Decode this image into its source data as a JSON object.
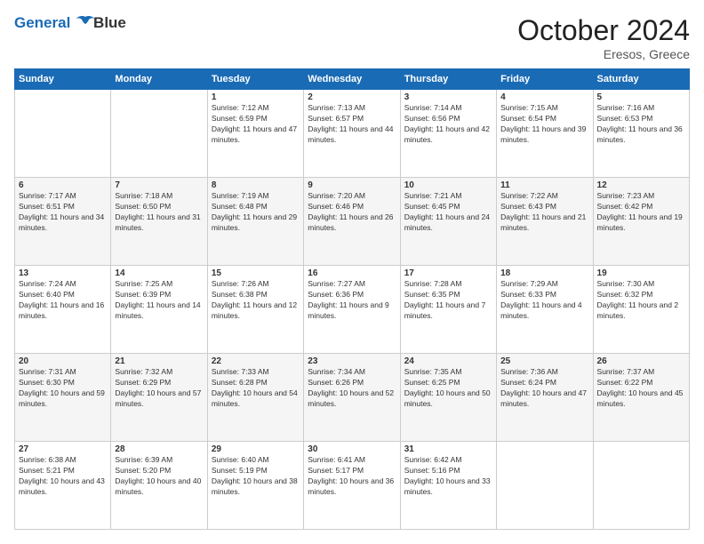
{
  "header": {
    "logo_line1": "General",
    "logo_line2": "Blue",
    "month": "October 2024",
    "location": "Eresos, Greece"
  },
  "weekdays": [
    "Sunday",
    "Monday",
    "Tuesday",
    "Wednesday",
    "Thursday",
    "Friday",
    "Saturday"
  ],
  "weeks": [
    [
      {
        "day": null,
        "content": null
      },
      {
        "day": null,
        "content": null
      },
      {
        "day": "1",
        "content": "Sunrise: 7:12 AM\nSunset: 6:59 PM\nDaylight: 11 hours and 47 minutes."
      },
      {
        "day": "2",
        "content": "Sunrise: 7:13 AM\nSunset: 6:57 PM\nDaylight: 11 hours and 44 minutes."
      },
      {
        "day": "3",
        "content": "Sunrise: 7:14 AM\nSunset: 6:56 PM\nDaylight: 11 hours and 42 minutes."
      },
      {
        "day": "4",
        "content": "Sunrise: 7:15 AM\nSunset: 6:54 PM\nDaylight: 11 hours and 39 minutes."
      },
      {
        "day": "5",
        "content": "Sunrise: 7:16 AM\nSunset: 6:53 PM\nDaylight: 11 hours and 36 minutes."
      }
    ],
    [
      {
        "day": "6",
        "content": "Sunrise: 7:17 AM\nSunset: 6:51 PM\nDaylight: 11 hours and 34 minutes."
      },
      {
        "day": "7",
        "content": "Sunrise: 7:18 AM\nSunset: 6:50 PM\nDaylight: 11 hours and 31 minutes."
      },
      {
        "day": "8",
        "content": "Sunrise: 7:19 AM\nSunset: 6:48 PM\nDaylight: 11 hours and 29 minutes."
      },
      {
        "day": "9",
        "content": "Sunrise: 7:20 AM\nSunset: 6:46 PM\nDaylight: 11 hours and 26 minutes."
      },
      {
        "day": "10",
        "content": "Sunrise: 7:21 AM\nSunset: 6:45 PM\nDaylight: 11 hours and 24 minutes."
      },
      {
        "day": "11",
        "content": "Sunrise: 7:22 AM\nSunset: 6:43 PM\nDaylight: 11 hours and 21 minutes."
      },
      {
        "day": "12",
        "content": "Sunrise: 7:23 AM\nSunset: 6:42 PM\nDaylight: 11 hours and 19 minutes."
      }
    ],
    [
      {
        "day": "13",
        "content": "Sunrise: 7:24 AM\nSunset: 6:40 PM\nDaylight: 11 hours and 16 minutes."
      },
      {
        "day": "14",
        "content": "Sunrise: 7:25 AM\nSunset: 6:39 PM\nDaylight: 11 hours and 14 minutes."
      },
      {
        "day": "15",
        "content": "Sunrise: 7:26 AM\nSunset: 6:38 PM\nDaylight: 11 hours and 12 minutes."
      },
      {
        "day": "16",
        "content": "Sunrise: 7:27 AM\nSunset: 6:36 PM\nDaylight: 11 hours and 9 minutes."
      },
      {
        "day": "17",
        "content": "Sunrise: 7:28 AM\nSunset: 6:35 PM\nDaylight: 11 hours and 7 minutes."
      },
      {
        "day": "18",
        "content": "Sunrise: 7:29 AM\nSunset: 6:33 PM\nDaylight: 11 hours and 4 minutes."
      },
      {
        "day": "19",
        "content": "Sunrise: 7:30 AM\nSunset: 6:32 PM\nDaylight: 11 hours and 2 minutes."
      }
    ],
    [
      {
        "day": "20",
        "content": "Sunrise: 7:31 AM\nSunset: 6:30 PM\nDaylight: 10 hours and 59 minutes."
      },
      {
        "day": "21",
        "content": "Sunrise: 7:32 AM\nSunset: 6:29 PM\nDaylight: 10 hours and 57 minutes."
      },
      {
        "day": "22",
        "content": "Sunrise: 7:33 AM\nSunset: 6:28 PM\nDaylight: 10 hours and 54 minutes."
      },
      {
        "day": "23",
        "content": "Sunrise: 7:34 AM\nSunset: 6:26 PM\nDaylight: 10 hours and 52 minutes."
      },
      {
        "day": "24",
        "content": "Sunrise: 7:35 AM\nSunset: 6:25 PM\nDaylight: 10 hours and 50 minutes."
      },
      {
        "day": "25",
        "content": "Sunrise: 7:36 AM\nSunset: 6:24 PM\nDaylight: 10 hours and 47 minutes."
      },
      {
        "day": "26",
        "content": "Sunrise: 7:37 AM\nSunset: 6:22 PM\nDaylight: 10 hours and 45 minutes."
      }
    ],
    [
      {
        "day": "27",
        "content": "Sunrise: 6:38 AM\nSunset: 5:21 PM\nDaylight: 10 hours and 43 minutes."
      },
      {
        "day": "28",
        "content": "Sunrise: 6:39 AM\nSunset: 5:20 PM\nDaylight: 10 hours and 40 minutes."
      },
      {
        "day": "29",
        "content": "Sunrise: 6:40 AM\nSunset: 5:19 PM\nDaylight: 10 hours and 38 minutes."
      },
      {
        "day": "30",
        "content": "Sunrise: 6:41 AM\nSunset: 5:17 PM\nDaylight: 10 hours and 36 minutes."
      },
      {
        "day": "31",
        "content": "Sunrise: 6:42 AM\nSunset: 5:16 PM\nDaylight: 10 hours and 33 minutes."
      },
      {
        "day": null,
        "content": null
      },
      {
        "day": null,
        "content": null
      }
    ]
  ]
}
